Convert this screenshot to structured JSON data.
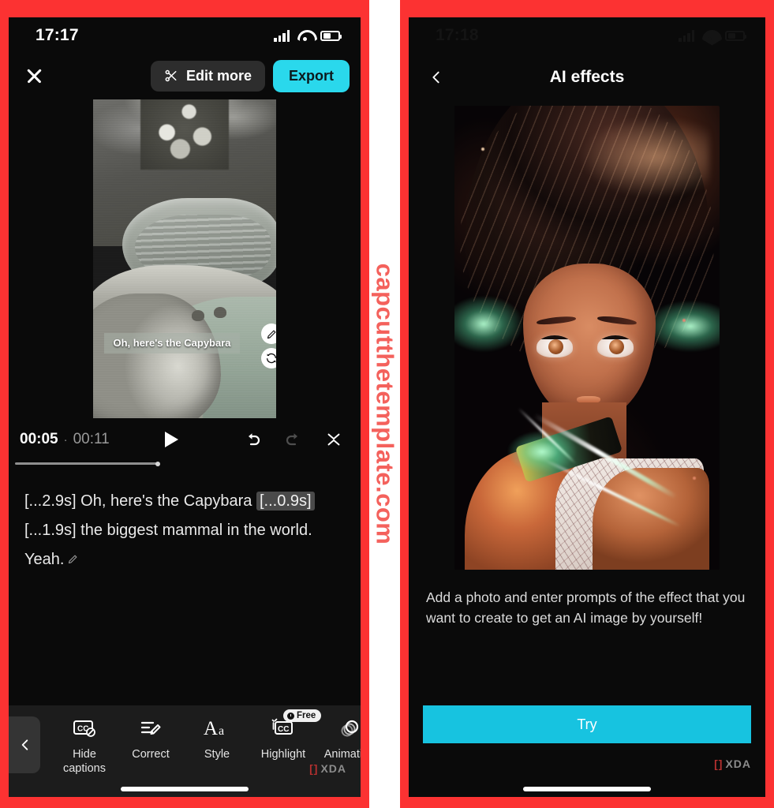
{
  "left_phone": {
    "status_bar": {
      "time": "17:17",
      "signal_icon": "cellular-signal-icon",
      "wifi_icon": "wifi-icon",
      "battery_icon": "battery-icon"
    },
    "topbar": {
      "close_icon": "close-icon",
      "edit_more_label": "Edit more",
      "scissors_icon": "scissors-icon",
      "export_label": "Export"
    },
    "preview": {
      "caption_overlay": "Oh, here's the Capybara",
      "edit_caption_icon": "pencil-icon",
      "regenerate_caption_icon": "refresh-icon"
    },
    "controls": {
      "current_time": "00:05",
      "separator": "·",
      "total_time": "00:11",
      "play_icon": "play-icon",
      "undo_icon": "undo-icon",
      "redo_icon": "redo-icon",
      "collapse_icon": "collapse-icon",
      "progress_percent": 42
    },
    "transcript": {
      "seg1_ts": "[...2.9s]",
      "seg1_text": "Oh, here's the Capybara",
      "seg1_chip": "[...0.9s]",
      "seg2_ts": "[...1.9s]",
      "seg2_text": "the biggest mammal in the world.",
      "seg3_text": "Yeah.",
      "edit_icon": "pencil-icon"
    },
    "toolbar": {
      "back_icon": "chevron-left-icon",
      "items": [
        {
          "label": "Hide\ncaptions",
          "label_line1": "Hide",
          "label_line2": "captions",
          "icon": "cc-hidden-icon",
          "badge": ""
        },
        {
          "label": "Correct",
          "icon": "correct-edit-icon",
          "badge": ""
        },
        {
          "label": "Style",
          "icon": "font-style-icon",
          "badge": ""
        },
        {
          "label": "Highlight",
          "icon": "cc-highlight-icon",
          "badge": "Free"
        },
        {
          "label": "Animation",
          "icon": "animation-rings-icon",
          "badge": ""
        }
      ]
    },
    "xda_watermark": "XDA"
  },
  "right_phone": {
    "status_bar": {
      "time": "17:18",
      "signal_icon": "cellular-signal-icon",
      "wifi_icon": "wifi-icon",
      "battery_icon": "battery-icon"
    },
    "header": {
      "back_icon": "chevron-left-icon",
      "title": "AI effects"
    },
    "media": {
      "alt_name": "ai-effect-anime-portrait-preview"
    },
    "description": "Add a photo and enter prompts of the effect that you want to create to get an AI image by yourself!",
    "try_button_label": "Try",
    "xda_watermark": "XDA"
  },
  "watermark": {
    "text": "capcutthetemplate.com",
    "color": "#f4615c"
  },
  "colors": {
    "frame_red": "#fc3232",
    "accent_cyan": "#2ad8ec",
    "try_cyan": "#17c3e0",
    "phone_bg": "#0a0a0a",
    "toolbar_bg": "#1c1c1c"
  }
}
